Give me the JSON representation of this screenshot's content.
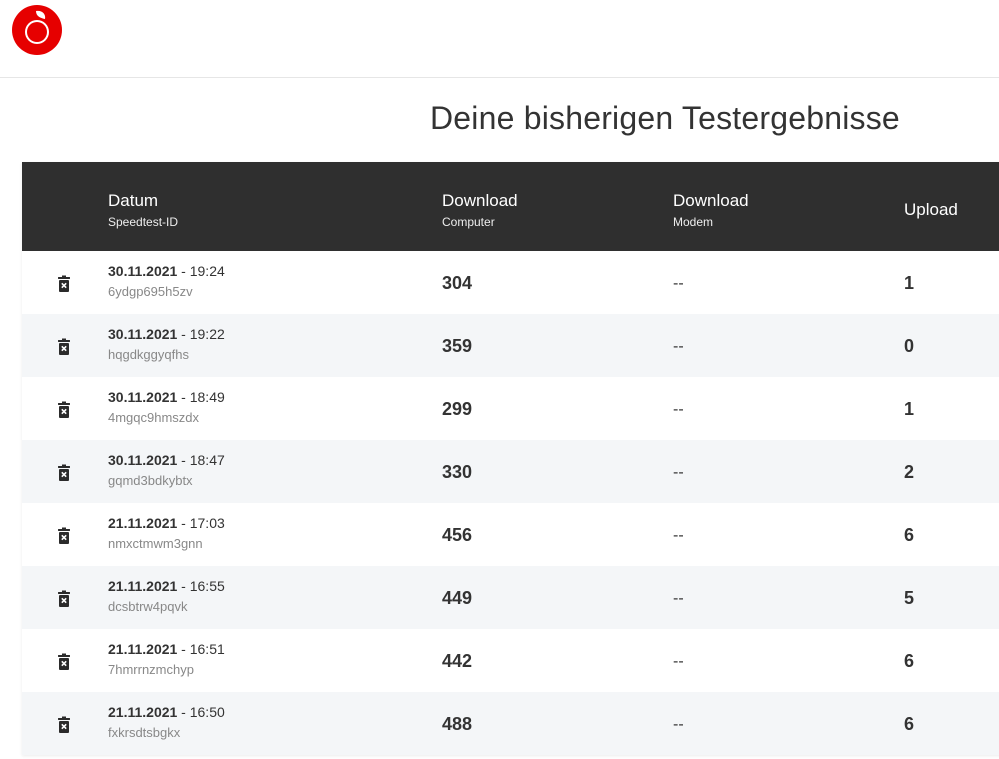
{
  "header": {
    "logo": "vodafone-logo"
  },
  "page": {
    "title": "Deine bisherigen Testergebnisse"
  },
  "table": {
    "columns": [
      {
        "main": "Datum",
        "sub": "Speedtest-ID"
      },
      {
        "main": "Download",
        "sub": "Computer"
      },
      {
        "main": "Download",
        "sub": "Modem"
      },
      {
        "main": "Upload",
        "sub": ""
      }
    ],
    "rows": [
      {
        "date": "30.11.2021",
        "time": " - 19:24",
        "id": "6ydgp695h5zv",
        "download_computer": "304",
        "download_modem": "--",
        "upload": "1"
      },
      {
        "date": "30.11.2021",
        "time": " - 19:22",
        "id": "hqgdkggyqfhs",
        "download_computer": "359",
        "download_modem": "--",
        "upload": "0"
      },
      {
        "date": "30.11.2021",
        "time": " - 18:49",
        "id": "4mgqc9hmszdx",
        "download_computer": "299",
        "download_modem": "--",
        "upload": "1"
      },
      {
        "date": "30.11.2021",
        "time": " - 18:47",
        "id": "gqmd3bdkybtx",
        "download_computer": "330",
        "download_modem": "--",
        "upload": "2"
      },
      {
        "date": "21.11.2021",
        "time": " - 17:03",
        "id": "nmxctmwm3gnn",
        "download_computer": "456",
        "download_modem": "--",
        "upload": "6"
      },
      {
        "date": "21.11.2021",
        "time": " - 16:55",
        "id": "dcsbtrw4pqvk",
        "download_computer": "449",
        "download_modem": "--",
        "upload": "5"
      },
      {
        "date": "21.11.2021",
        "time": " - 16:51",
        "id": "7hmrrnzmchyp",
        "download_computer": "442",
        "download_modem": "--",
        "upload": "6"
      },
      {
        "date": "21.11.2021",
        "time": " - 16:50",
        "id": "fxkrsdtsbgkx",
        "download_computer": "488",
        "download_modem": "--",
        "upload": "6"
      }
    ]
  },
  "colors": {
    "brand": "#e60000",
    "header_bg": "#2f2f2f",
    "row_alt": "#f4f6f8"
  }
}
